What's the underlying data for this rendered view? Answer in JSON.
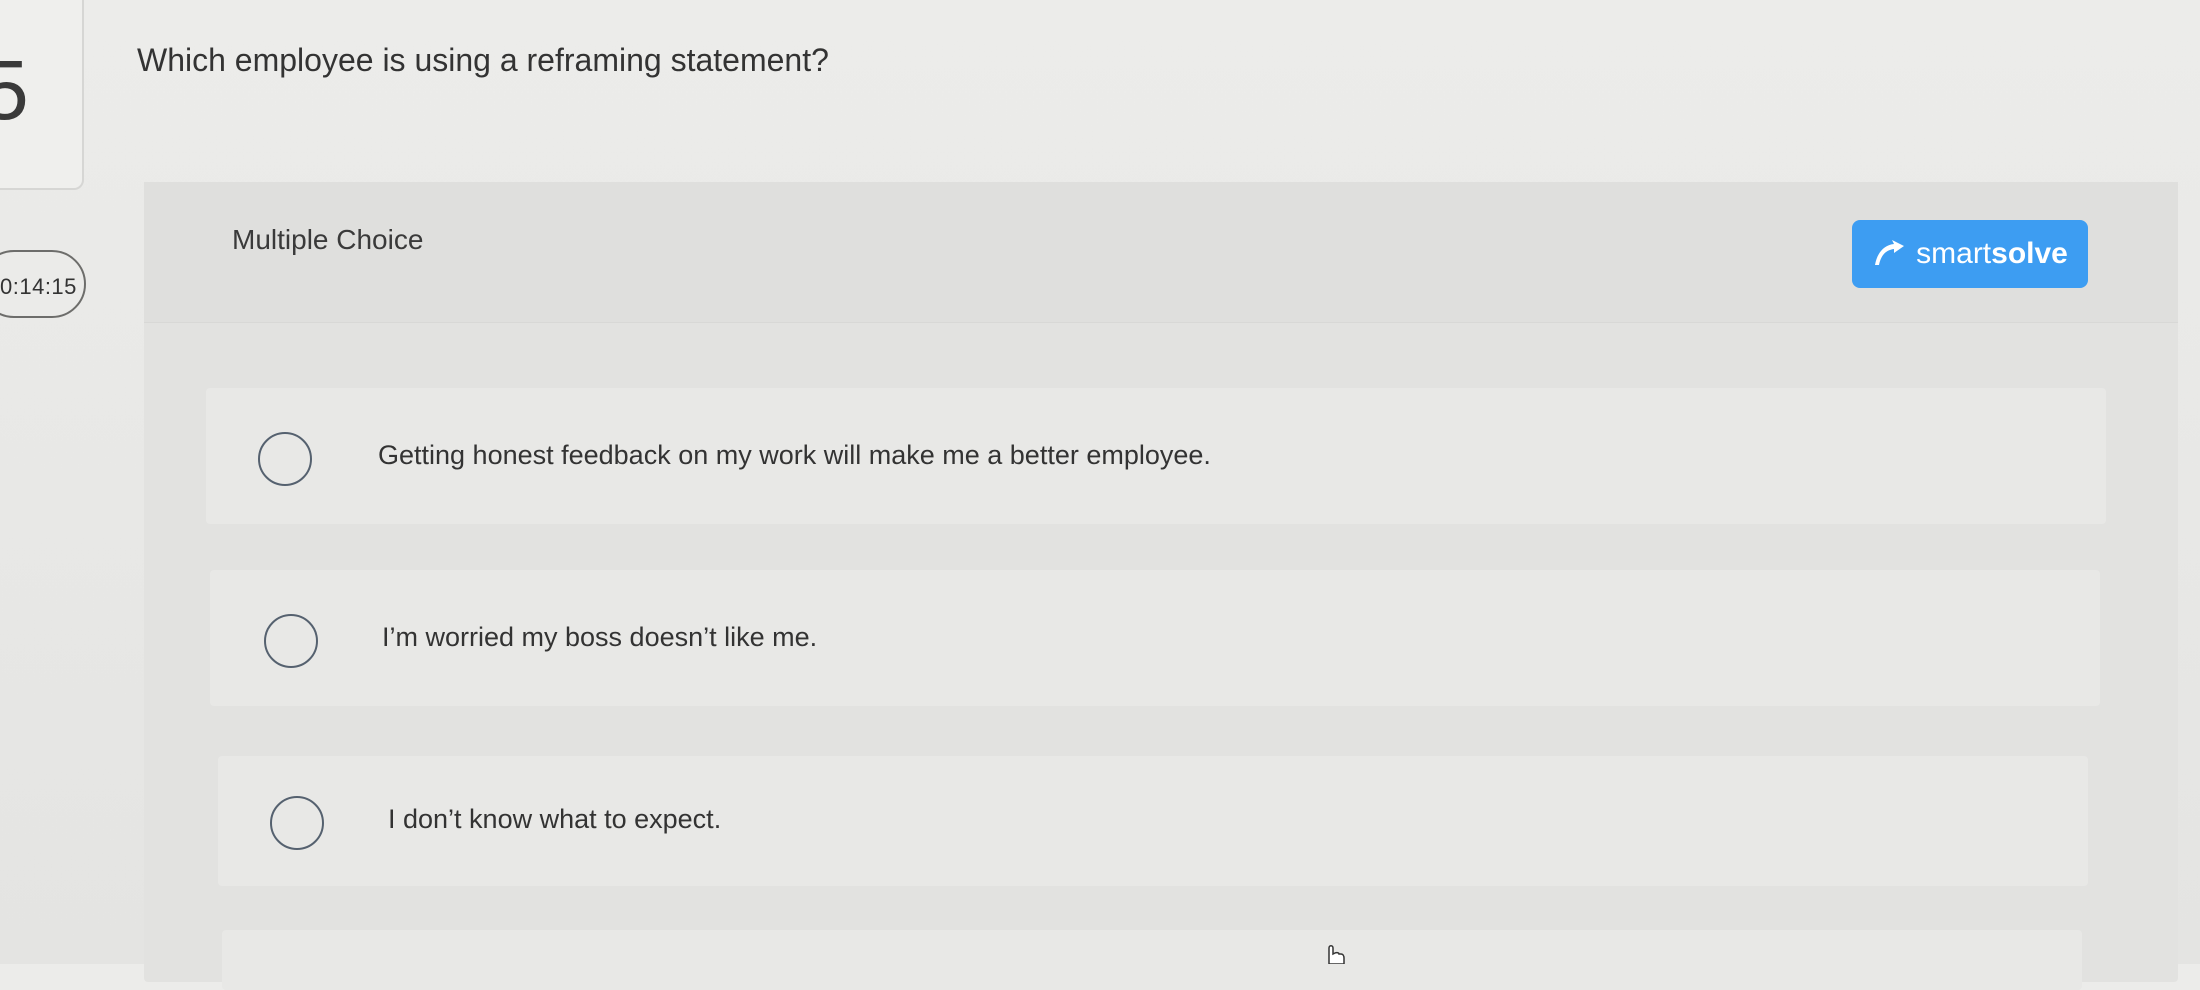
{
  "question": {
    "number": "5",
    "text": "Which employee is using a reframing statement?"
  },
  "timer": {
    "value": "0:14:15"
  },
  "question_type": "Multiple Choice",
  "smartsolve": {
    "label_light": "smart",
    "label_bold": "solve",
    "color": "#3d9df2",
    "icon": "smartsolve-logo-icon"
  },
  "options": [
    {
      "text": "Getting honest feedback on my work will make me a better employee.",
      "selected": false
    },
    {
      "text": "I’m worried my boss doesn’t like me.",
      "selected": false
    },
    {
      "text": "I don’t know what to expect.",
      "selected": false
    }
  ]
}
